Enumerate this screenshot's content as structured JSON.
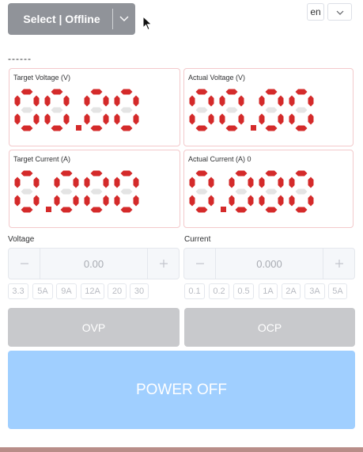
{
  "header": {
    "select_label": "Select | Offline",
    "lang_value": "en"
  },
  "status_text": "------",
  "displays": {
    "target_voltage": {
      "label": "Target Voltage (V)",
      "value": "00.00"
    },
    "actual_voltage": {
      "label": "Actual Voltage (V)",
      "value": "00.00"
    },
    "target_current": {
      "label": "Target Current (A)",
      "value": "0.000"
    },
    "actual_current": {
      "label": "Actual Current (A) 0",
      "value": "0.000"
    }
  },
  "segment_colors": {
    "on": "#d42a2a",
    "off": "#e4e4e4"
  },
  "voltage": {
    "label": "Voltage",
    "value": "0.00",
    "presets": [
      "3.3",
      "5A",
      "9A",
      "12A",
      "20",
      "30"
    ]
  },
  "current": {
    "label": "Current",
    "value": "0.000",
    "presets": [
      "0.1",
      "0.2",
      "0.5",
      "1A",
      "2A",
      "3A",
      "5A"
    ]
  },
  "buttons": {
    "ovp": "OVP",
    "ocp": "OCP",
    "power": "POWER OFF"
  },
  "colors": {
    "select_bg": "#909399",
    "protect_bg": "#c8c9cc",
    "power_bg": "#a0cfff",
    "panel_border": "#f3c9cb"
  }
}
